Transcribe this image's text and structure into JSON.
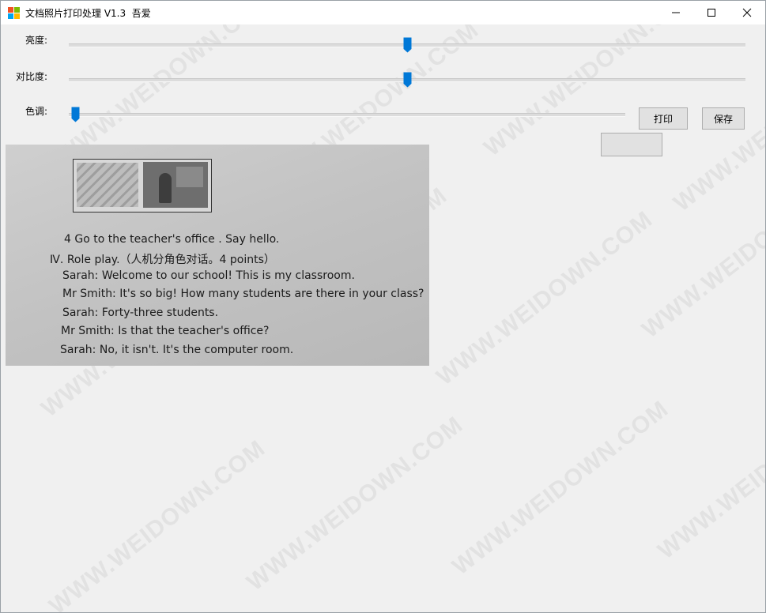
{
  "window": {
    "title": "文档照片打印处理 V1.3  吾爱",
    "minimize_glyph": "—",
    "maximize_glyph": "☐",
    "close_glyph": "✕"
  },
  "controls": {
    "brightness": {
      "label": "亮度:",
      "value_fraction": 0.5
    },
    "contrast": {
      "label": "对比度:",
      "value_fraction": 0.5
    },
    "hue": {
      "label": "色调:",
      "value_fraction": 0.0
    }
  },
  "buttons": {
    "print_label": "打印",
    "save_label": "保存",
    "blank_label": ""
  },
  "photo": {
    "lines": [
      "4 Go to the teacher's office . Say hello.",
      "Ⅳ. Role play.（人机分角色对话。4 points）",
      "Sarah: Welcome to our school! This is my classroom.",
      "Mr Smith: It's so big! How many students are there in your class?",
      "Sarah: Forty-three students.",
      "Mr Smith: Is that the teacher's office?",
      "Sarah: No, it isn't. It's the computer room."
    ]
  },
  "watermark": {
    "text": "WWW.WEIDOWN.COM"
  },
  "colors": {
    "slider_thumb": "#0078d7",
    "window_bg": "#f0f0f0",
    "titlebar_bg": "#ffffff"
  }
}
